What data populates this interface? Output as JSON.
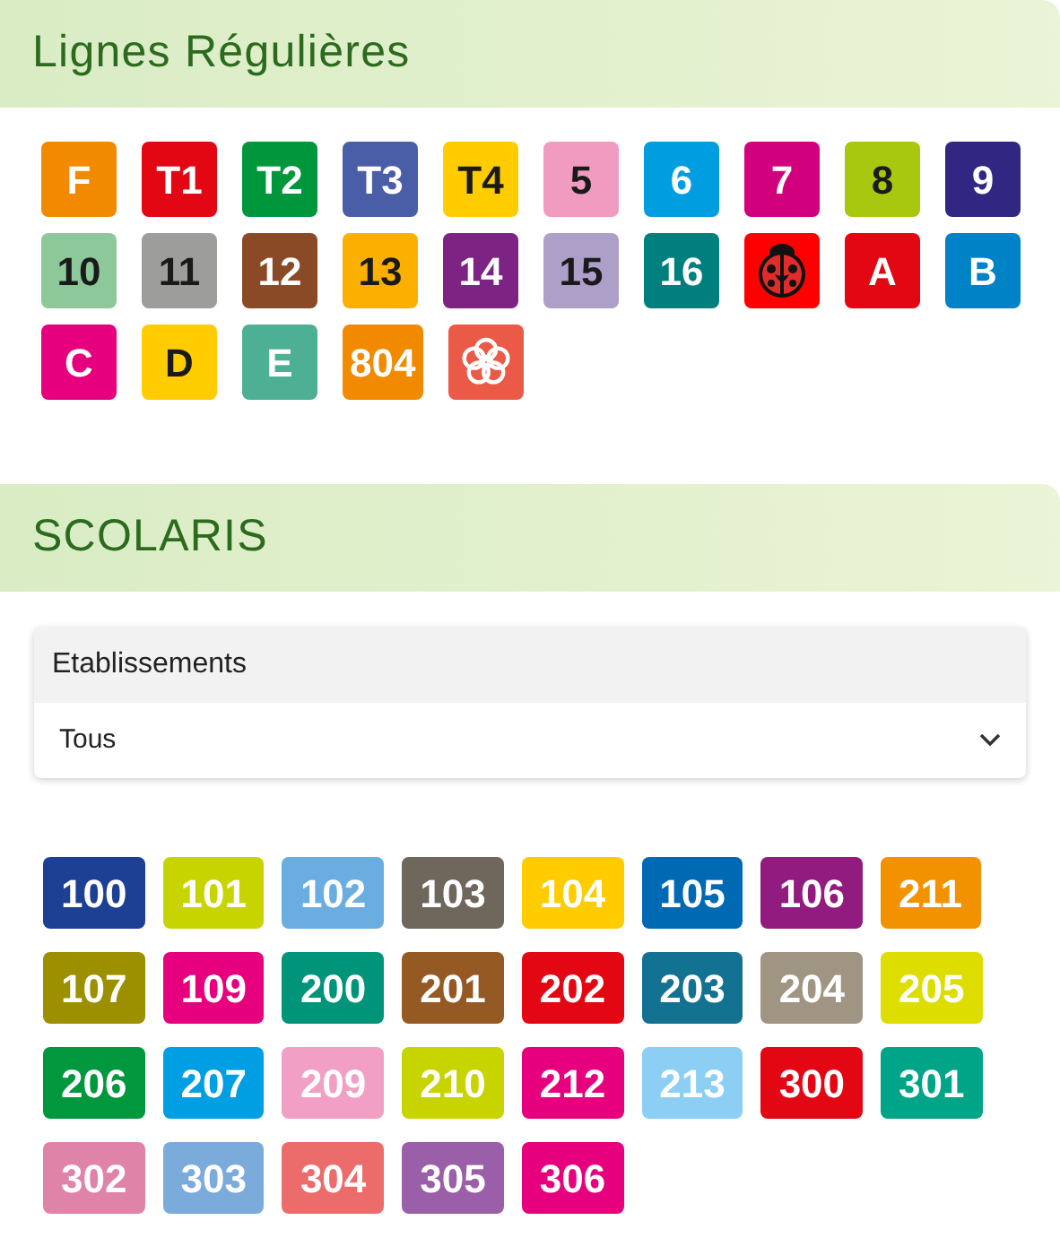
{
  "sections": [
    {
      "title": "Lignes Régulières"
    },
    {
      "title": "SCOLARIS"
    }
  ],
  "lines": [
    {
      "kind": "text",
      "label": "F",
      "color": "#f28a00",
      "dark": false
    },
    {
      "kind": "text",
      "label": "T1",
      "color": "#e30613",
      "dark": false
    },
    {
      "kind": "text",
      "label": "T2",
      "color": "#00963c",
      "dark": false
    },
    {
      "kind": "text",
      "label": "T3",
      "color": "#4a5ea8",
      "dark": false
    },
    {
      "kind": "text",
      "label": "T4",
      "color": "#ffcc00",
      "dark": true
    },
    {
      "kind": "text",
      "label": "5",
      "color": "#f29bc1",
      "dark": true
    },
    {
      "kind": "text",
      "label": "6",
      "color": "#009ee0",
      "dark": false
    },
    {
      "kind": "text",
      "label": "7",
      "color": "#d1007d",
      "dark": false
    },
    {
      "kind": "text",
      "label": "8",
      "color": "#a8c80f",
      "dark": true
    },
    {
      "kind": "text",
      "label": "9",
      "color": "#312783",
      "dark": false
    },
    {
      "kind": "text",
      "label": "10",
      "color": "#8dc89b",
      "dark": true
    },
    {
      "kind": "text",
      "label": "11",
      "color": "#9d9d9c",
      "dark": true
    },
    {
      "kind": "text",
      "label": "12",
      "color": "#8a4a26",
      "dark": false
    },
    {
      "kind": "text",
      "label": "13",
      "color": "#fbb000",
      "dark": true
    },
    {
      "kind": "text",
      "label": "14",
      "color": "#7c2383",
      "dark": false
    },
    {
      "kind": "text",
      "label": "15",
      "color": "#ad9fc8",
      "dark": true
    },
    {
      "kind": "text",
      "label": "16",
      "color": "#007f7f",
      "dark": false
    },
    {
      "kind": "ladybug",
      "color": "#ff0000"
    },
    {
      "kind": "text",
      "label": "A",
      "color": "#e30613",
      "dark": false
    },
    {
      "kind": "text",
      "label": "B",
      "color": "#0082c6",
      "dark": false
    },
    {
      "kind": "text",
      "label": "C",
      "color": "#e6007e",
      "dark": false
    },
    {
      "kind": "text",
      "label": "D",
      "color": "#ffcc00",
      "dark": true
    },
    {
      "kind": "text",
      "label": "E",
      "color": "#4daf93",
      "dark": false
    },
    {
      "kind": "text",
      "label": "804",
      "color": "#f28a00",
      "dark": false
    },
    {
      "kind": "flower",
      "color": "#ea5a47"
    }
  ],
  "filter": {
    "label": "Etablissements",
    "value": "Tous"
  },
  "school_lines": [
    {
      "label": "100",
      "color": "#1d3f94"
    },
    {
      "label": "101",
      "color": "#c8d400"
    },
    {
      "label": "102",
      "color": "#6aade0"
    },
    {
      "label": "103",
      "color": "#6f665c"
    },
    {
      "label": "104",
      "color": "#ffcc00"
    },
    {
      "label": "105",
      "color": "#0069b4"
    },
    {
      "label": "106",
      "color": "#911b7e"
    },
    {
      "label": "211",
      "color": "#f39200"
    },
    {
      "label": "107",
      "color": "#9c8f00"
    },
    {
      "label": "109",
      "color": "#e6007e"
    },
    {
      "label": "200",
      "color": "#00957a"
    },
    {
      "label": "201",
      "color": "#955a24"
    },
    {
      "label": "202",
      "color": "#e30613"
    },
    {
      "label": "203",
      "color": "#137192"
    },
    {
      "label": "204",
      "color": "#a09483"
    },
    {
      "label": "205",
      "color": "#dddd00"
    },
    {
      "label": "206",
      "color": "#00973d"
    },
    {
      "label": "207",
      "color": "#009fe3"
    },
    {
      "label": "209",
      "color": "#f29fc5"
    },
    {
      "label": "210",
      "color": "#c8d400"
    },
    {
      "label": "212",
      "color": "#e6007e"
    },
    {
      "label": "213",
      "color": "#8dcff4"
    },
    {
      "label": "300",
      "color": "#e30613"
    },
    {
      "label": "301",
      "color": "#00a486"
    },
    {
      "label": "302",
      "color": "#e083a8"
    },
    {
      "label": "303",
      "color": "#7aabdb"
    },
    {
      "label": "304",
      "color": "#ec6b6b"
    },
    {
      "label": "305",
      "color": "#9b5ea8"
    },
    {
      "label": "306",
      "color": "#e6007e"
    }
  ]
}
